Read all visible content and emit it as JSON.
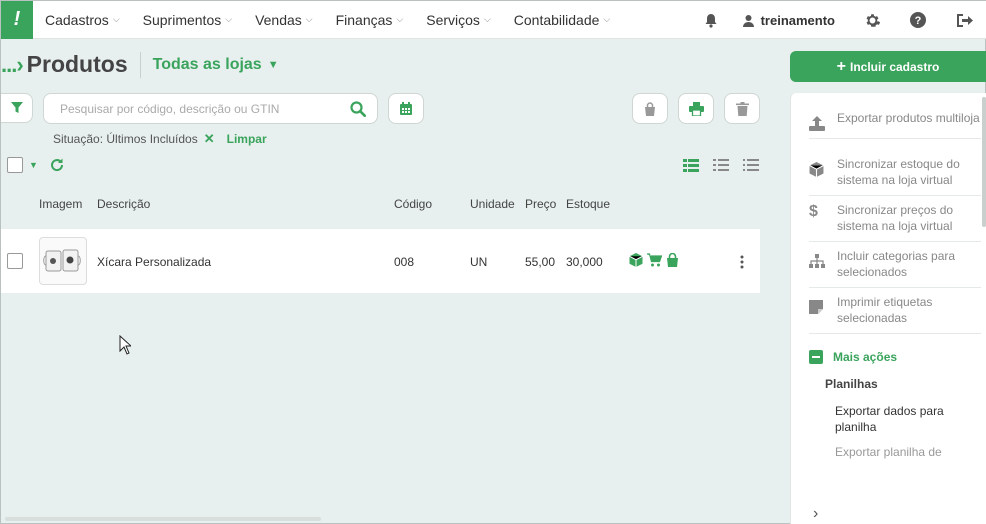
{
  "nav": {
    "logo_glyph": "!",
    "items": [
      "Cadastros",
      "Suprimentos",
      "Vendas",
      "Finanças",
      "Serviços",
      "Contabilidade"
    ],
    "username": "treinamento"
  },
  "header": {
    "breadcrumb": "...",
    "title": "Produtos",
    "store_selector": "Todas as lojas"
  },
  "search": {
    "placeholder": "Pesquisar por código, descrição ou GTIN",
    "value": ""
  },
  "filters": {
    "active_tag": "Situação: Últimos Incluídos",
    "clear_label": "Limpar"
  },
  "table": {
    "headers": [
      "Imagem",
      "Descrição",
      "Código",
      "Unidade",
      "Preço",
      "Estoque"
    ],
    "rows": [
      {
        "descricao": "Xícara Personalizada",
        "codigo": "008",
        "unidade": "UN",
        "preco": "55,00",
        "estoque": "30,000"
      }
    ]
  },
  "sidebar": {
    "primary_button": "Incluir cadastro",
    "actions": [
      {
        "label": "Exportar produtos multiloja",
        "icon": "upload-icon"
      },
      {
        "label": "Sincronizar estoque do sistema na loja virtual",
        "icon": "box-icon"
      },
      {
        "label": "Sincronizar preços do sistema na loja virtual",
        "icon": "dollar-icon"
      },
      {
        "label": "Incluir categorias para selecionados",
        "icon": "sitemap-icon"
      },
      {
        "label": "Imprimir etiquetas selecionadas",
        "icon": "sticky-note-icon"
      }
    ],
    "more_actions": "Mais ações",
    "planilhas_heading": "Planilhas",
    "planilhas_items": [
      "Exportar dados para planilha",
      "Exportar planilha de"
    ]
  },
  "colors": {
    "accent": "#3aa35c",
    "background": "#e7f0ee"
  }
}
